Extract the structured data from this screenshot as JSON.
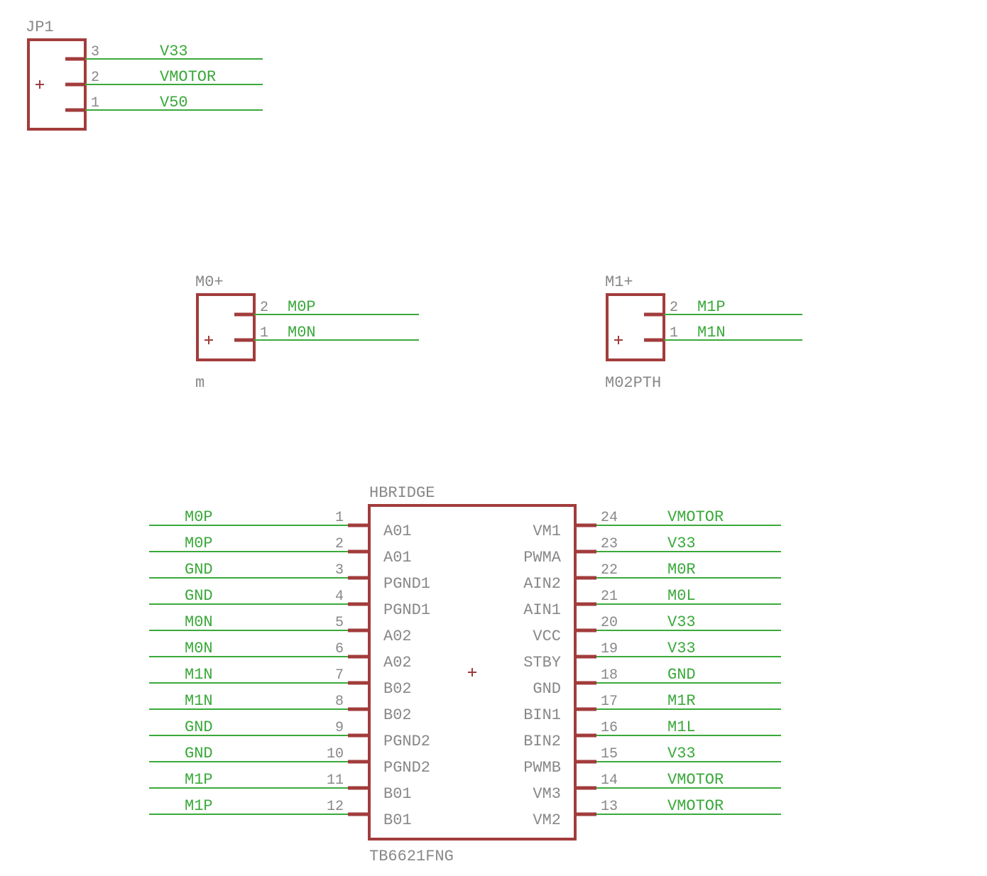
{
  "jp1": {
    "ref": "JP1",
    "pins": [
      {
        "num": "3",
        "net": "V33"
      },
      {
        "num": "2",
        "net": "VMOTOR"
      },
      {
        "num": "1",
        "net": "V50"
      }
    ]
  },
  "m0": {
    "ref": "M0+",
    "value": "m",
    "pins": [
      {
        "num": "2",
        "net": "M0P"
      },
      {
        "num": "1",
        "net": "M0N"
      }
    ]
  },
  "m1": {
    "ref": "M1+",
    "value": "M02PTH",
    "pins": [
      {
        "num": "2",
        "net": "M1P"
      },
      {
        "num": "1",
        "net": "M1N"
      }
    ]
  },
  "hbridge": {
    "ref": "HBRIDGE",
    "value": "TB6621FNG",
    "left": [
      {
        "num": "1",
        "name": "A01",
        "net": "M0P"
      },
      {
        "num": "2",
        "name": "A01",
        "net": "M0P"
      },
      {
        "num": "3",
        "name": "PGND1",
        "net": "GND"
      },
      {
        "num": "4",
        "name": "PGND1",
        "net": "GND"
      },
      {
        "num": "5",
        "name": "A02",
        "net": "M0N"
      },
      {
        "num": "6",
        "name": "A02",
        "net": "M0N"
      },
      {
        "num": "7",
        "name": "B02",
        "net": "M1N"
      },
      {
        "num": "8",
        "name": "B02",
        "net": "M1N"
      },
      {
        "num": "9",
        "name": "PGND2",
        "net": "GND"
      },
      {
        "num": "10",
        "name": "PGND2",
        "net": "GND"
      },
      {
        "num": "11",
        "name": "B01",
        "net": "M1P"
      },
      {
        "num": "12",
        "name": "B01",
        "net": "M1P"
      }
    ],
    "right": [
      {
        "num": "24",
        "name": "VM1",
        "net": "VMOTOR"
      },
      {
        "num": "23",
        "name": "PWMA",
        "net": "V33"
      },
      {
        "num": "22",
        "name": "AIN2",
        "net": "M0R"
      },
      {
        "num": "21",
        "name": "AIN1",
        "net": "M0L"
      },
      {
        "num": "20",
        "name": "VCC",
        "net": "V33"
      },
      {
        "num": "19",
        "name": "STBY",
        "net": "V33"
      },
      {
        "num": "18",
        "name": "GND",
        "net": "GND"
      },
      {
        "num": "17",
        "name": "BIN1",
        "net": "M1R"
      },
      {
        "num": "16",
        "name": "BIN2",
        "net": "M1L"
      },
      {
        "num": "15",
        "name": "PWMB",
        "net": "V33"
      },
      {
        "num": "14",
        "name": "VM3",
        "net": "VMOTOR"
      },
      {
        "num": "13",
        "name": "VM2",
        "net": "VMOTOR"
      }
    ]
  }
}
